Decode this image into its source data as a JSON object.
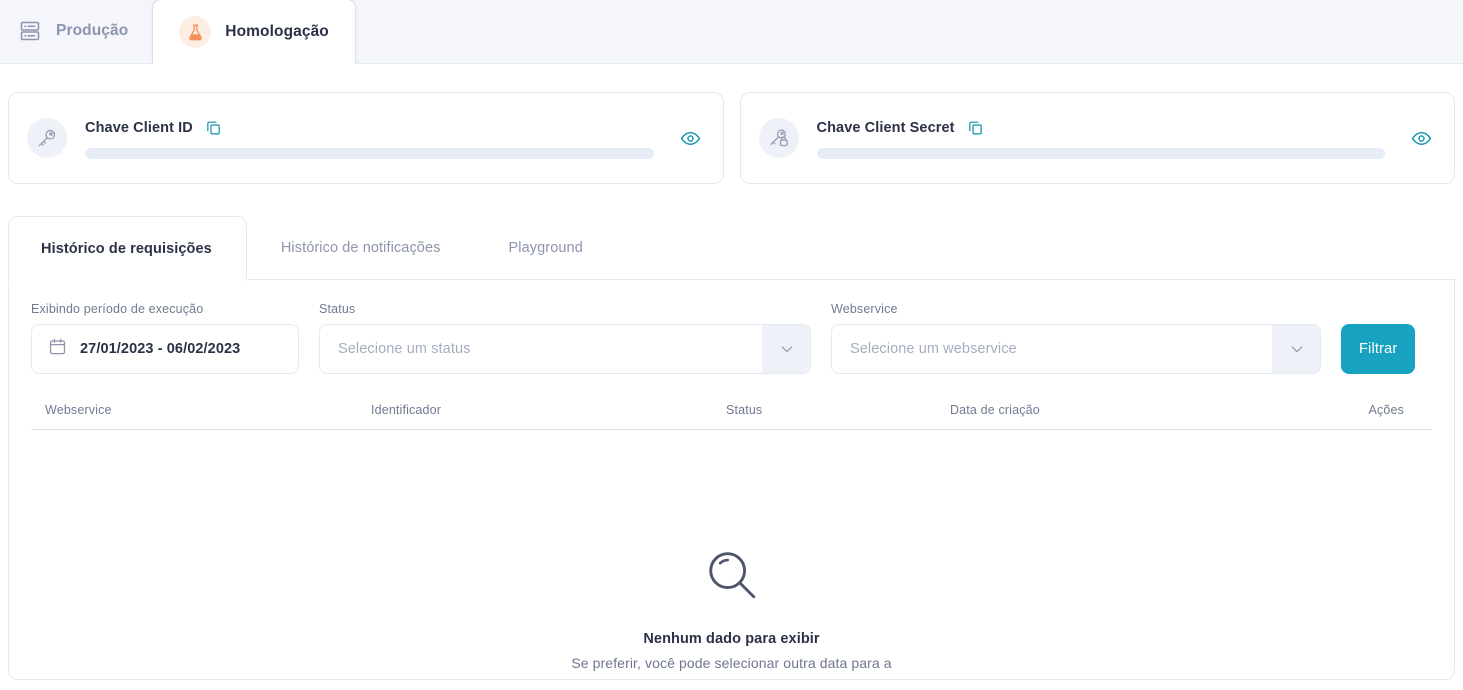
{
  "env_bar": {
    "tabs": [
      {
        "label": "Produção",
        "icon": "server-icon",
        "active": false
      },
      {
        "label": "Homologação",
        "icon": "flask-icon",
        "active": true
      }
    ]
  },
  "credentials": [
    {
      "title": "Chave Client ID",
      "avatar_icon": "key-icon",
      "copy_icon": "copy-icon",
      "reveal_icon": "eye-icon",
      "value": ""
    },
    {
      "title": "Chave Client Secret",
      "avatar_icon": "key-lock-icon",
      "copy_icon": "copy-icon",
      "reveal_icon": "eye-icon",
      "value": ""
    }
  ],
  "tabs": [
    {
      "label": "Histórico de requisições",
      "active": true
    },
    {
      "label": "Histórico de notificações",
      "active": false
    },
    {
      "label": "Playground",
      "active": false
    }
  ],
  "filters": {
    "date": {
      "label": "Exibindo período de execução",
      "value": "27/01/2023 - 06/02/2023",
      "icon": "calendar-icon"
    },
    "status": {
      "label": "Status",
      "placeholder": "Selecione um status",
      "value": "",
      "icon": "chevron-down-icon"
    },
    "webservice": {
      "label": "Webservice",
      "placeholder": "Selecione um webservice",
      "value": "",
      "icon": "chevron-down-icon"
    },
    "submit_label": "Filtrar"
  },
  "table": {
    "columns": [
      "Webservice",
      "Identificador",
      "Status",
      "Data de criação",
      "Ações"
    ],
    "rows": []
  },
  "empty_state": {
    "icon": "magnifier-icon",
    "title": "Nenhum dado para exibir",
    "subtitle": "Se preferir, você pode selecionar outra data para a"
  },
  "colors": {
    "accent_teal": "#17a2c0",
    "accent_orange": "#f59158",
    "page_bg": "#ffffff",
    "bar_bg": "#f4f6fb",
    "border": "#e2eaf4",
    "text_dark": "#2b3247",
    "text_muted": "#8d95ad",
    "skeleton": "#e7edf6"
  }
}
